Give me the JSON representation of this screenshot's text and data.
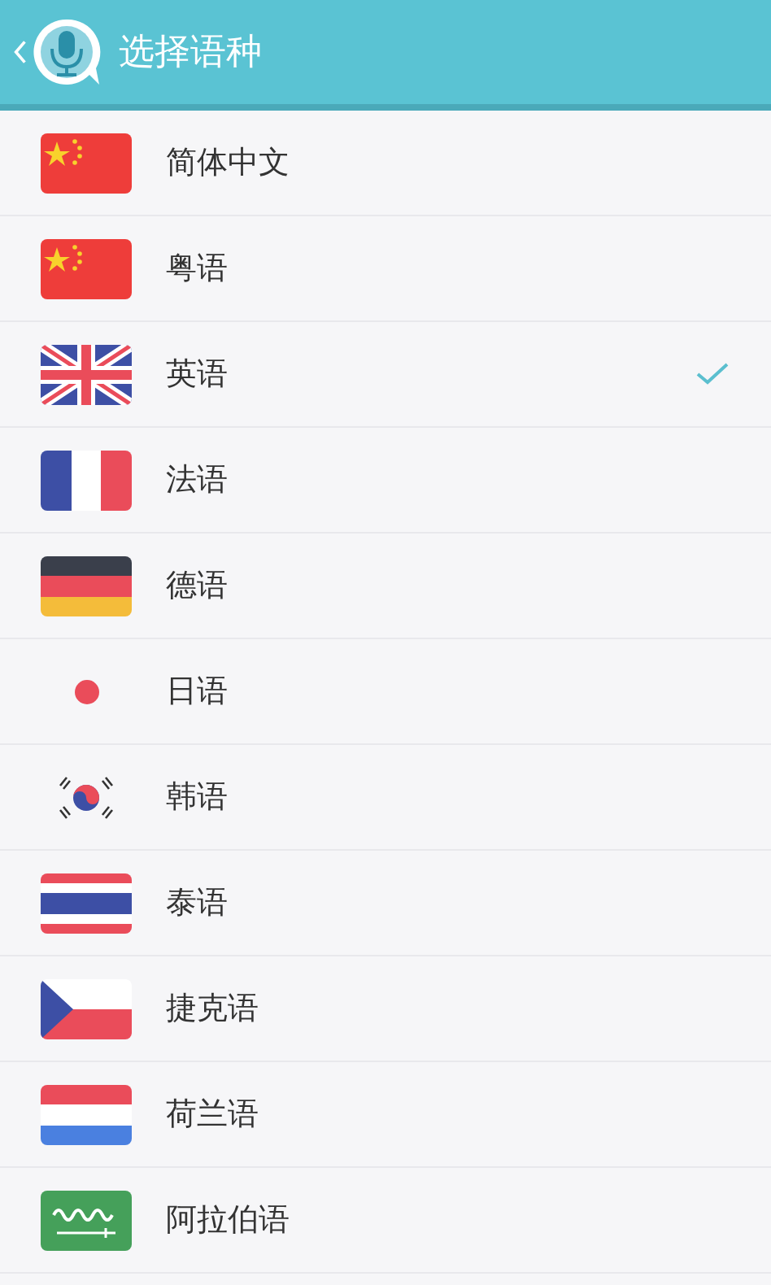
{
  "header": {
    "title": "选择语种"
  },
  "languages": [
    {
      "name": "简体中文",
      "kind": "china",
      "selected": false
    },
    {
      "name": "粤语",
      "kind": "china",
      "selected": false
    },
    {
      "name": "英语",
      "kind": "uk",
      "selected": true
    },
    {
      "name": "法语",
      "kind": "france",
      "selected": false
    },
    {
      "name": "德语",
      "kind": "germany",
      "selected": false
    },
    {
      "name": "日语",
      "kind": "japan",
      "selected": false
    },
    {
      "name": "韩语",
      "kind": "korea",
      "selected": false
    },
    {
      "name": "泰语",
      "kind": "thailand",
      "selected": false
    },
    {
      "name": "捷克语",
      "kind": "czech",
      "selected": false
    },
    {
      "name": "荷兰语",
      "kind": "netherlands",
      "selected": false
    },
    {
      "name": "阿拉伯语",
      "kind": "saudi",
      "selected": false
    }
  ]
}
